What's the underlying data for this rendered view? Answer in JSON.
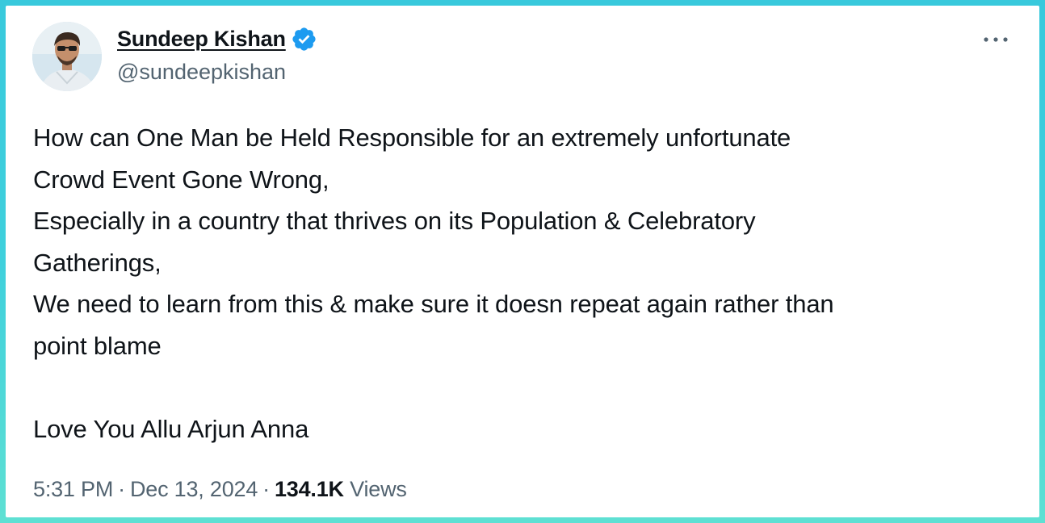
{
  "author": {
    "display_name": "Sundeep Kishan",
    "handle": "@sundeepkishan",
    "verified": true
  },
  "tweet": {
    "lines": [
      "How can One Man be Held Responsible for an extremely unfortunate",
      "Crowd Event Gone Wrong,",
      "Especially in a country that thrives on its Population & Celebratory",
      "Gatherings,",
      "We need to learn from this & make sure it doesn repeat again rather than",
      "point blame",
      "",
      "Love You Allu Arjun Anna"
    ]
  },
  "meta": {
    "time": "5:31 PM",
    "separator": "·",
    "date": "Dec 13, 2024",
    "views_count": "134.1K",
    "views_label": "Views"
  },
  "icons": {
    "verified": "verified-badge-icon",
    "more": "more-options-icon"
  },
  "colors": {
    "frame_gradient_top": "#38c9dc",
    "frame_gradient_bottom": "#5ee0d3",
    "verified_blue": "#1d9bf0",
    "primary_text": "#0f1419",
    "secondary_text": "#536471"
  }
}
